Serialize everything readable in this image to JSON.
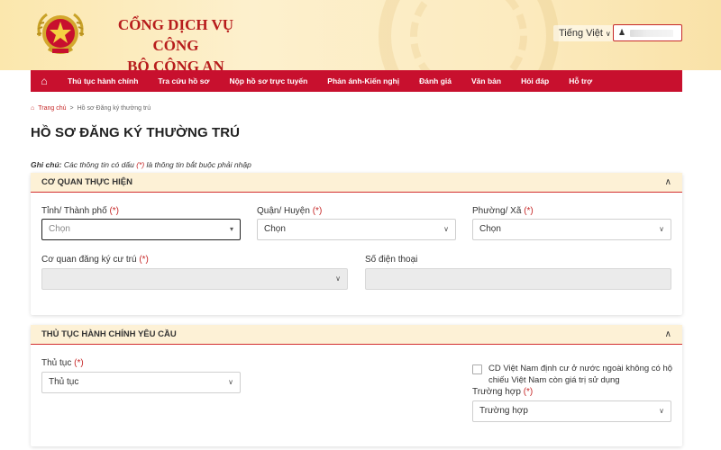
{
  "header": {
    "title_line1": "CỔNG DỊCH VỤ CÔNG",
    "title_line2": "BỘ CÔNG AN",
    "language": "Tiếng Việt",
    "user_icon": "user-icon",
    "brand_color": "#c8102e"
  },
  "nav": {
    "home_icon": "home-icon",
    "items": [
      "Thủ tục hành chính",
      "Tra cứu hồ sơ",
      "Nộp hồ sơ trực tuyến",
      "Phản ánh-Kiến nghị",
      "Đánh giá",
      "Văn bản",
      "Hỏi đáp",
      "Hỗ trợ"
    ]
  },
  "breadcrumb": {
    "home": "Trang chủ",
    "separator": ">",
    "current": "Hồ sơ Đăng ký thường trú"
  },
  "page_title": "HỒ SƠ ĐĂNG KÝ THƯỜNG TRÚ",
  "note": {
    "label": "Ghi chú:",
    "text_before": " Các thông tin có dấu ",
    "required_mark": "(*)",
    "text_after": " là thông tin bắt buộc phải nhập"
  },
  "section1": {
    "title": "CƠ QUAN THỰC HIỆN",
    "province_label": "Tỉnh/ Thành phố",
    "province_value": "Chọn",
    "district_label": "Quận/ Huyện",
    "district_value": "Chọn",
    "ward_label": "Phường/ Xã",
    "ward_value": "Chọn",
    "agency_label": "Cơ quan đăng ký cư trú",
    "agency_value": "",
    "phone_label": "Số điện thoại",
    "phone_value": "",
    "required_mark": "(*)"
  },
  "section2": {
    "title": "THỦ TỤC HÀNH CHÍNH YÊU CẦU",
    "procedure_label": "Thủ tục",
    "procedure_value": "Thủ tục",
    "checkbox_line1": "CD Việt Nam định cư ở nước ngoài không có hộ",
    "checkbox_line2": "chiếu Việt Nam còn giá trị sử dụng",
    "checkbox_checked": false,
    "case_label": "Trường hợp",
    "case_value": "Trường hợp",
    "required_mark": "(*)"
  }
}
